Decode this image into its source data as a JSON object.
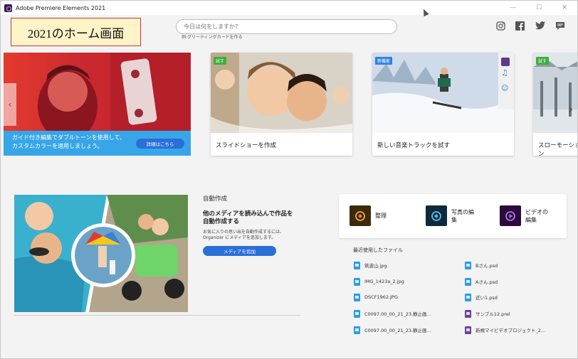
{
  "window": {
    "title": "Adobe Premiere Elements 2021",
    "minimize": "—",
    "maximize": "☐",
    "close": "✕"
  },
  "annotation": "2021のホーム画面",
  "search": {
    "placeholder": "今日は何をしますか?",
    "hint": "例:グリーティングカードを作る"
  },
  "social": [
    "instagram-icon",
    "facebook-icon",
    "twitter-icon",
    "comment-icon"
  ],
  "hero": {
    "text": "ガイド付き編集でダブルトーンを使用して、カスタムカラーを適用しましょう。",
    "button": "詳細はこちら"
  },
  "cards": [
    {
      "badge": "試す",
      "label": "スライドショーを作成"
    },
    {
      "badge": "新機能",
      "label": "新しい音楽トラックを試す"
    },
    {
      "badge": "試す",
      "label": "スローモーション"
    }
  ],
  "auto": {
    "title": "自動作成",
    "heading": "他のメディアを読み込んで作品を自動作成する",
    "desc": "お気に入りの思い出を自動作成するには、Organizer にメディアを追加します。",
    "button": "メディアを追加"
  },
  "quick_actions": [
    {
      "label": "整理",
      "color": "#3d2a08",
      "accent": "#f3a53c"
    },
    {
      "label": "写真の編集",
      "color": "#0d2a3d",
      "accent": "#5fb8f0"
    },
    {
      "label": "ビデオの編集",
      "color": "#2a0a3a",
      "accent": "#b86ef0"
    }
  ],
  "recent": {
    "title": "最近使用したファイル",
    "left": [
      {
        "name": "筑波山.jpg",
        "type": "jpg"
      },
      {
        "name": "IMG_1423a_2.jpg",
        "type": "jpg"
      },
      {
        "name": "DSCF1962.JPG",
        "type": "jpg"
      },
      {
        "name": "C0097.00_00_21_23.静止画…",
        "type": "jpg"
      },
      {
        "name": "C0097.00_00_21_23.静止画…",
        "type": "jpg"
      }
    ],
    "right": [
      {
        "name": "Bさん.psd",
        "type": "psd"
      },
      {
        "name": "Aさん.psd",
        "type": "psd"
      },
      {
        "name": "近い1.psd",
        "type": "psd"
      },
      {
        "name": "サンプル12.prel",
        "type": "prel"
      },
      {
        "name": "新規マイビデオプロジェクト_2…",
        "type": "prel"
      }
    ]
  }
}
